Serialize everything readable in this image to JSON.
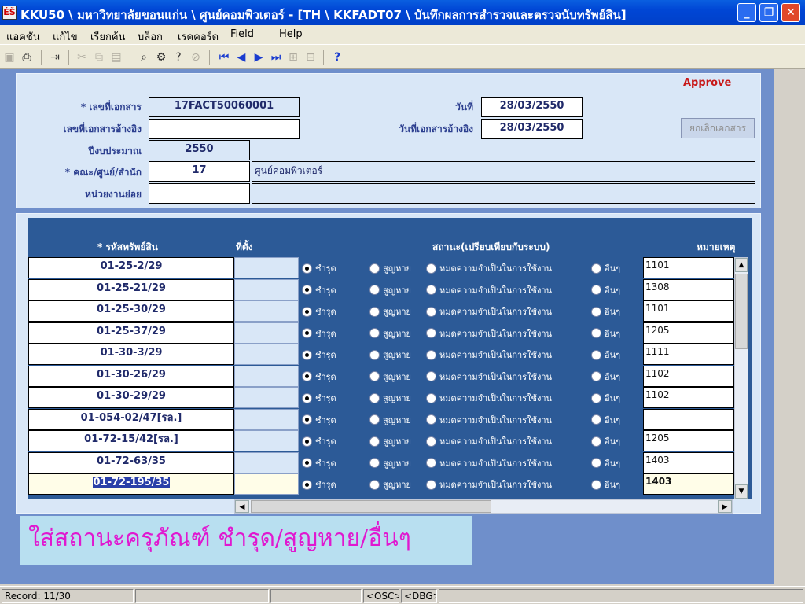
{
  "window": {
    "title": "KKU50 \\ มหาวิทยาลัยขอนแก่น \\ ศูนย์คอมพิวเตอร์ - [TH \\ KKFADT07 \\ บันทึกผลการสำรวจและตรวจนับทรัพย์สิน]",
    "icon_text": "ÉŠ"
  },
  "menu": [
    "แอคชัน",
    "แก้ไข",
    "เรียกค้น",
    "บล็อก",
    "เรคคอร์ด",
    "Field",
    "Help"
  ],
  "toolbar_icons": [
    "save-icon",
    "print-preview-icon",
    "exit-icon",
    "cut-icon",
    "copy-icon",
    "paste-icon",
    "query-icon",
    "execute-query-icon",
    "count-query-icon",
    "cancel-query-icon",
    "first-record-icon",
    "previous-record-icon",
    "next-record-icon",
    "last-record-icon",
    "insert-record-icon",
    "delete-record-icon",
    "help-icon"
  ],
  "header": {
    "status": "Approve",
    "doc_no_label": "* เลขที่เอกสาร",
    "doc_no": "17FACT50060001",
    "ref_doc_label": "เลขที่เอกสารอ้างอิง",
    "ref_doc": "",
    "fiscal_year_label": "ปีงบประมาณ",
    "fiscal_year": "2550",
    "faculty_label": "* คณะ/ศูนย์/สำนัก",
    "faculty_code": "17",
    "faculty_name": "ศูนย์คอมพิวเตอร์",
    "subunit_label": "หน่วยงานย่อย",
    "subunit_code": "",
    "subunit_name": "",
    "date_label": "วันที่",
    "date": "28/03/2550",
    "ref_date_label": "วันที่เอกสารอ้างอิง",
    "ref_date": "28/03/2550",
    "cancel_button": "ยกเลิกเอกสาร"
  },
  "grid": {
    "col_asset": "* รหัสทรัพย์สิน",
    "col_location": "ที่ตั้ง",
    "col_status": "สถานะ(เปรียบเทียบกับระบบ)",
    "col_note": "หมายเหตุ",
    "status_options": [
      "ชำรุด",
      "สูญหาย",
      "หมดความจำเป็นในการใช้งาน",
      "อื่นๆ"
    ],
    "rows": [
      {
        "asset": "01-25-2/29",
        "location": "",
        "status": "ชำรุด",
        "note": "1101"
      },
      {
        "asset": "01-25-21/29",
        "location": "",
        "status": "ชำรุด",
        "note": "1308"
      },
      {
        "asset": "01-25-30/29",
        "location": "",
        "status": "ชำรุด",
        "note": "1101"
      },
      {
        "asset": "01-25-37/29",
        "location": "",
        "status": "ชำรุด",
        "note": "1205"
      },
      {
        "asset": "01-30-3/29",
        "location": "",
        "status": "ชำรุด",
        "note": "1111"
      },
      {
        "asset": "01-30-26/29",
        "location": "",
        "status": "ชำรุด",
        "note": "1102"
      },
      {
        "asset": "01-30-29/29",
        "location": "",
        "status": "ชำรุด",
        "note": "1102"
      },
      {
        "asset": "01-054-02/47[รล.]",
        "location": "",
        "status": "ชำรุด",
        "note": ""
      },
      {
        "asset": "01-72-15/42[รล.]",
        "location": "",
        "status": "ชำรุด",
        "note": "1205"
      },
      {
        "asset": "01-72-63/35",
        "location": "",
        "status": "ชำรุด",
        "note": "1403"
      },
      {
        "asset": "01-72-195/35",
        "location": "",
        "status": "ชำรุด",
        "note": "1403",
        "current": true
      }
    ]
  },
  "instruction": "ใส่สถานะครุภัณฑ์ ชำรุด/สูญหาย/อื่นๆ",
  "statusbar": {
    "record": "Record: 11/30",
    "osc": "<OSC>",
    "dbg": "<DBG>"
  }
}
